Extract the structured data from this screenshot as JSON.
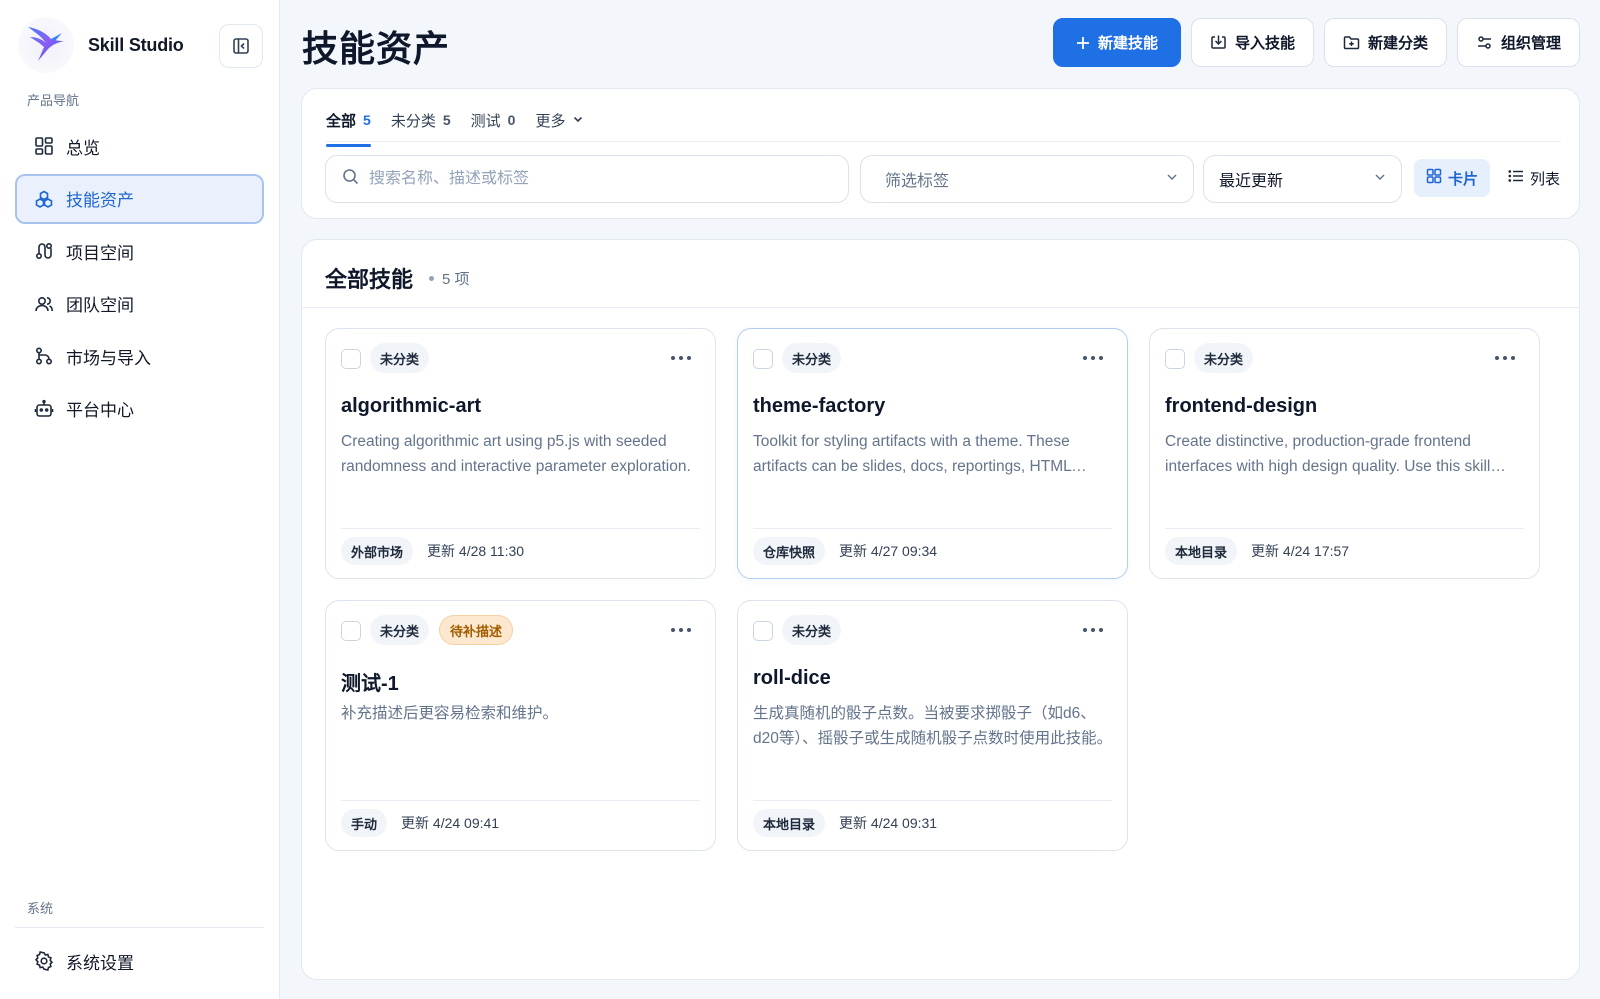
{
  "brand": {
    "name": "Skill Studio"
  },
  "sidebar": {
    "section_label": "产品导航",
    "items": [
      {
        "label": "总览",
        "icon": "dashboard-icon",
        "active": false
      },
      {
        "label": "技能资产",
        "icon": "cubes-icon",
        "active": true
      },
      {
        "label": "项目空间",
        "icon": "route-icon",
        "active": false
      },
      {
        "label": "团队空间",
        "icon": "users-icon",
        "active": false
      },
      {
        "label": "市场与导入",
        "icon": "branch-icon",
        "active": false
      },
      {
        "label": "平台中心",
        "icon": "robot-icon",
        "active": false
      }
    ],
    "system_label": "系统",
    "system_item": {
      "label": "系统设置",
      "icon": "gear-icon"
    }
  },
  "header": {
    "title": "技能资产",
    "actions": {
      "new_skill": "新建技能",
      "import_skill": "导入技能",
      "new_category": "新建分类",
      "org_manage": "组织管理"
    }
  },
  "filters": {
    "tabs": [
      {
        "label": "全部",
        "count": "5",
        "active": true
      },
      {
        "label": "未分类",
        "count": "5",
        "active": false
      },
      {
        "label": "测试",
        "count": "0",
        "active": false
      }
    ],
    "more_label": "更多",
    "search": {
      "placeholder": "搜索名称、描述或标签",
      "value": ""
    },
    "tag_filter": {
      "placeholder": "筛选标签"
    },
    "sort": {
      "value": "最近更新"
    },
    "view": {
      "card": "卡片",
      "list": "列表",
      "active": "card"
    }
  },
  "skills": {
    "title": "全部技能",
    "count_label": "5 项",
    "cards": [
      {
        "category": "未分类",
        "badge": "",
        "name": "algorithmic-art",
        "description": "Creating algorithmic art using p5.js with seeded randomness and interactive parameter exploration.",
        "source": "外部市场",
        "updated": "更新 4/28 11:30"
      },
      {
        "category": "未分类",
        "badge": "",
        "name": "theme-factory",
        "description": "Toolkit for styling artifacts with a theme. These artifacts can be slides, docs, reportings, HTML landing pages, etc.",
        "source": "仓库快照",
        "updated": "更新 4/27 09:34"
      },
      {
        "category": "未分类",
        "badge": "",
        "name": "frontend-design",
        "description": "Create distinctive, production-grade frontend interfaces with high design quality. Use this skill when the user asks to build web components.",
        "source": "本地目录",
        "updated": "更新 4/24 17:57"
      },
      {
        "category": "未分类",
        "badge": "待补描述",
        "name": "测试-1",
        "description": "补充描述后更容易检索和维护。",
        "source": "手动",
        "updated": "更新 4/24 09:41"
      },
      {
        "category": "未分类",
        "badge": "",
        "name": "roll-dice",
        "description": "生成真随机的骰子点数。当被要求掷骰子（如d6、d20等）、摇骰子或生成随机骰子点数时使用此技能。",
        "source": "本地目录",
        "updated": "更新 4/24 09:31"
      }
    ]
  },
  "colors": {
    "accent": "#1f6fe5",
    "active_nav_bg": "#eaf1fc",
    "warn_badge_bg": "#fbe8cf"
  }
}
